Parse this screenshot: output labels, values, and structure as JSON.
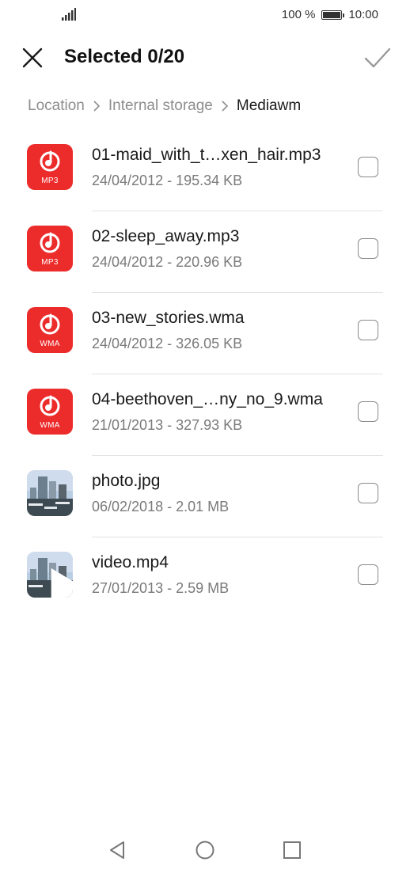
{
  "status_bar": {
    "battery_text": "100 %",
    "time": "10:00",
    "icons": [
      "signal-icon",
      "battery-icon"
    ]
  },
  "app_bar": {
    "title": "Selected 0/20",
    "icons": [
      "close-icon",
      "checkmark-icon"
    ]
  },
  "breadcrumb": [
    "Location",
    "Internal storage",
    "Mediawm"
  ],
  "files": [
    {
      "name": "01-maid_with_t…xen_hair.mp3",
      "meta": "24/04/2012 - 195.34 KB",
      "kind": "audio",
      "badge": "MP3",
      "checked": false
    },
    {
      "name": "02-sleep_away.mp3",
      "meta": "24/04/2012 - 220.96 KB",
      "kind": "audio",
      "badge": "MP3",
      "checked": false
    },
    {
      "name": "03-new_stories.wma",
      "meta": "24/04/2012 - 326.05 KB",
      "kind": "audio",
      "badge": "WMA",
      "checked": false
    },
    {
      "name": "04-beethoven_…ny_no_9.wma",
      "meta": "21/01/2013 - 327.93 KB",
      "kind": "audio",
      "badge": "WMA",
      "checked": false
    },
    {
      "name": "photo.jpg",
      "meta": "06/02/2018 - 2.01 MB",
      "kind": "image",
      "checked": false
    },
    {
      "name": "video.mp4",
      "meta": "27/01/2013 - 2.59 MB",
      "kind": "video",
      "checked": false
    }
  ],
  "nav_bar": {
    "icons": [
      "back-icon",
      "home-icon",
      "recents-icon"
    ]
  },
  "colors": {
    "audio_icon": "#ec2b2b",
    "text_primary": "#1a1a1a",
    "text_secondary": "#7a7a7a",
    "breadcrumb_inactive": "#8e8e8e"
  }
}
